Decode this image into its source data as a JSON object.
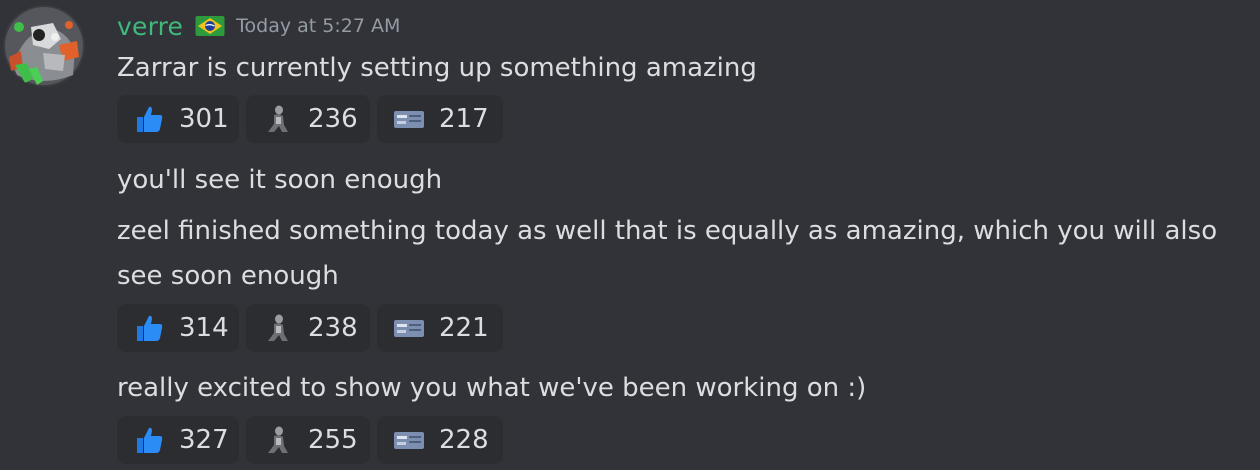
{
  "author": {
    "name": "verre",
    "timestamp": "Today at 5:27 AM",
    "role_icon": "green-flag-badge-icon",
    "name_color": "#3fb97c"
  },
  "messages": [
    {
      "text": "Zarrar is currently setting up something amazing"
    },
    {
      "text": "you'll see it soon enough"
    },
    {
      "lines": [
        "zeel finished something today as well that is equally as amazing, which you will also",
        "see soon enough"
      ]
    },
    {
      "text": "really excited to show you what we've been working on :)"
    }
  ],
  "reaction_groups": [
    {
      "reactions": [
        {
          "emoji": "thumbs-up",
          "count": "301"
        },
        {
          "emoji": "figure",
          "count": "236"
        },
        {
          "emoji": "card",
          "count": "217"
        }
      ]
    },
    {
      "reactions": [
        {
          "emoji": "thumbs-up",
          "count": "314"
        },
        {
          "emoji": "figure",
          "count": "238"
        },
        {
          "emoji": "card",
          "count": "221"
        }
      ]
    },
    {
      "reactions": [
        {
          "emoji": "thumbs-up",
          "count": "327"
        },
        {
          "emoji": "figure",
          "count": "255"
        },
        {
          "emoji": "card",
          "count": "228"
        }
      ]
    }
  ],
  "colors": {
    "background": "#313338",
    "reaction_bg": "#2b2d31",
    "text": "#dbdee1",
    "timestamp": "#949ba4",
    "thumb_blue": "#1f7ae8"
  }
}
